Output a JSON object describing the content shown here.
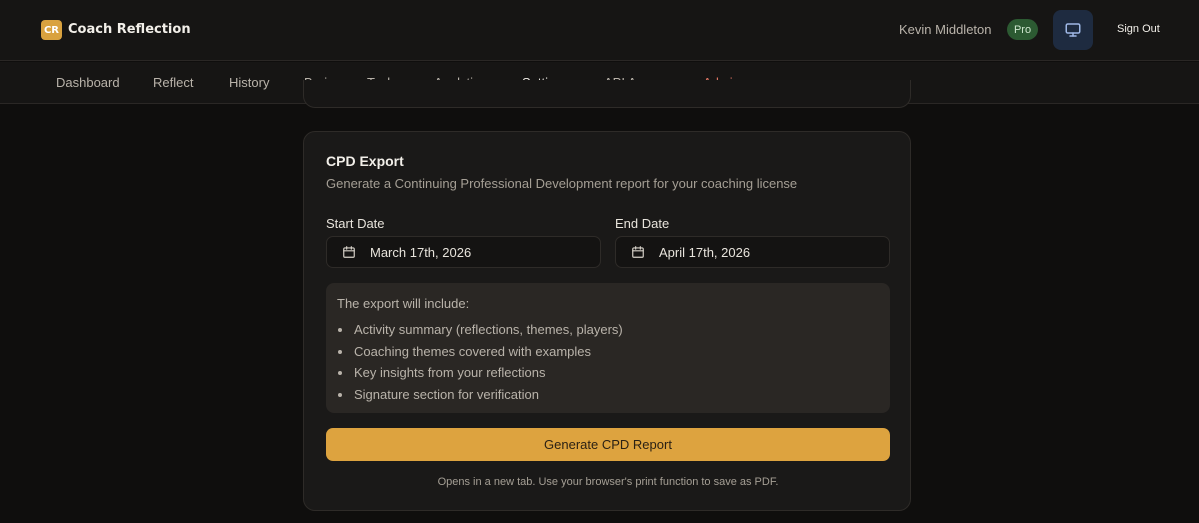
{
  "app": {
    "logo_text": "CR",
    "title": "Coach Reflection"
  },
  "header": {
    "user_name": "Kevin Middleton",
    "plan_badge": "Pro",
    "display_icon": "monitor-icon",
    "sign_out_label": "Sign Out"
  },
  "nav": {
    "items": [
      {
        "label": "Dashboard"
      },
      {
        "label": "Reflect"
      },
      {
        "label": "History"
      },
      {
        "label": "Brain"
      },
      {
        "label": "Tasks"
      },
      {
        "label": "Analytics"
      },
      {
        "label": "Settings",
        "active": true
      },
      {
        "label": "API Access"
      },
      {
        "label": "Admin"
      }
    ]
  },
  "cpd_export": {
    "title": "CPD Export",
    "subtitle": "Generate a Continuing Professional Development report for your coaching license",
    "start_date": {
      "label": "Start Date",
      "value": "March 17th, 2026",
      "icon": "calendar-icon"
    },
    "end_date": {
      "label": "End Date",
      "value": "April 17th, 2026",
      "icon": "calendar-icon"
    },
    "includes_heading": "The export will include:",
    "includes": [
      "Activity summary (reflections, themes, players)",
      "Coaching themes covered with examples",
      "Key insights from your reflections",
      "Signature section for verification"
    ],
    "generate_button": "Generate CPD Report",
    "footnote": "Opens in a new tab. Use your browser's print function to save as PDF."
  },
  "colors": {
    "accent": "#dda33f",
    "admin": "#e07664",
    "pro_badge": "#2c5a32",
    "background": "#0f0e0d"
  }
}
